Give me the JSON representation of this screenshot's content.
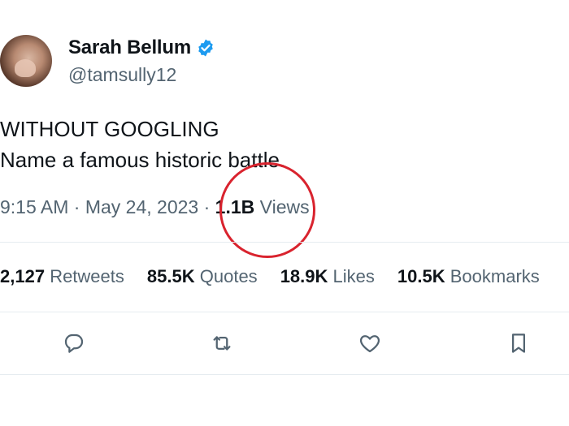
{
  "author": {
    "name": "Sarah Bellum",
    "handle": "@tamsully12",
    "verified_color": "#1d9bf0"
  },
  "tweet": {
    "line1": "WITHOUT GOOGLING",
    "line2": "Name a famous historic battle."
  },
  "meta": {
    "time": "9:15 AM",
    "sep1": " · ",
    "date": "May 24, 2023",
    "sep2": " · ",
    "views_count": "1.1B",
    "views_label": "Views"
  },
  "stats": {
    "retweets_count": "2,127",
    "retweets_label": "Retweets",
    "quotes_count": "85.5K",
    "quotes_label": "Quotes",
    "likes_count": "18.9K",
    "likes_label": "Likes",
    "bookmarks_count": "10.5K",
    "bookmarks_label": "Bookmarks"
  },
  "actions": [
    "reply-icon",
    "retweet-icon",
    "like-icon",
    "bookmark-icon"
  ],
  "colors": {
    "text": "#0f1419",
    "secondary": "#536471",
    "highlight_circle": "#d9232e",
    "divider": "#e6ecf0"
  }
}
